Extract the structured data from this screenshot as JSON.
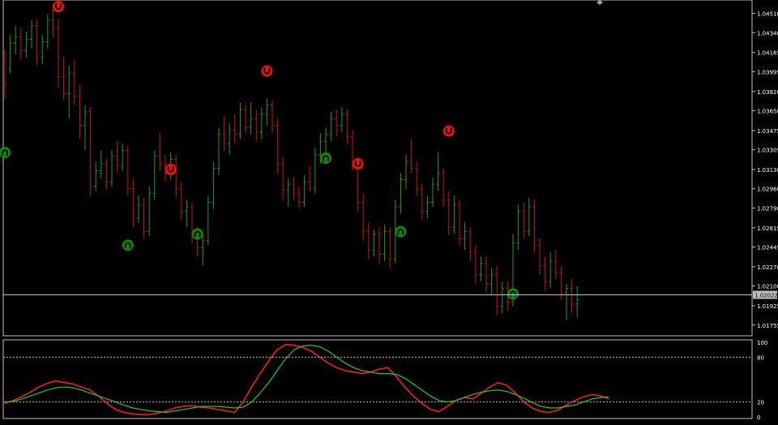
{
  "colors": {
    "background": "#000000",
    "frame": "#c0c0c0",
    "bull_bar": "#1f9a1f",
    "bear_bar": "#d01010",
    "stoch_main": "#ff1a1a",
    "stoch_signal": "#22cc22",
    "level_line": "#c0c0c0",
    "price_label_bg": "#c0c0c0",
    "axis_text": "#ffffff",
    "arrow_up": "#0a8a0a",
    "arrow_down": "#ee1111"
  },
  "chart_data": [
    {
      "type": "ohlc",
      "price_axis": {
        "ylim": [
          1.0166,
          1.046
        ],
        "ticks": [
          "1.04510",
          "1.04340",
          "1.04165",
          "1.03995",
          "1.03820",
          "1.03650",
          "1.03475",
          "1.03305",
          "1.03130",
          "1.02960",
          "1.02790",
          "1.02615",
          "1.02445",
          "1.02270",
          "1.02100",
          "1.01925",
          "1.01755"
        ],
        "current_price": "1.02022"
      },
      "bars": [
        [
          1.0408,
          1.0419,
          1.0376,
          1.0388
        ],
        [
          1.0402,
          1.0432,
          1.0398,
          1.0425
        ],
        [
          1.0425,
          1.044,
          1.0415,
          1.043
        ],
        [
          1.043,
          1.0438,
          1.041,
          1.0418
        ],
        [
          1.0418,
          1.0435,
          1.0412,
          1.0428
        ],
        [
          1.0428,
          1.0445,
          1.042,
          1.044
        ],
        [
          1.044,
          1.0446,
          1.0405,
          1.0412
        ],
        [
          1.0412,
          1.0432,
          1.0406,
          1.0426
        ],
        [
          1.0426,
          1.045,
          1.042,
          1.0445
        ],
        [
          1.0445,
          1.0455,
          1.043,
          1.0438
        ],
        [
          1.0438,
          1.0446,
          1.0385,
          1.0395
        ],
        [
          1.0395,
          1.0412,
          1.0375,
          1.038
        ],
        [
          1.038,
          1.0405,
          1.0358,
          1.0398
        ],
        [
          1.0398,
          1.041,
          1.037,
          1.0378
        ],
        [
          1.0378,
          1.0388,
          1.034,
          1.0352
        ],
        [
          1.0352,
          1.037,
          1.033,
          1.0364
        ],
        [
          1.0364,
          1.0368,
          1.029,
          1.0298
        ],
        [
          1.0298,
          1.032,
          1.0294,
          1.0312
        ],
        [
          1.0312,
          1.033,
          1.0305,
          1.0318
        ],
        [
          1.0318,
          1.0322,
          1.0296,
          1.0302
        ],
        [
          1.0302,
          1.033,
          1.0298,
          1.0325
        ],
        [
          1.0325,
          1.0338,
          1.031,
          1.0316
        ],
        [
          1.0316,
          1.0336,
          1.0312,
          1.033
        ],
        [
          1.033,
          1.0334,
          1.029,
          1.0296
        ],
        [
          1.0296,
          1.0305,
          1.0262,
          1.027
        ],
        [
          1.027,
          1.029,
          1.0266,
          1.0282
        ],
        [
          1.0282,
          1.0288,
          1.0252,
          1.0258
        ],
        [
          1.0258,
          1.0298,
          1.0254,
          1.0292
        ],
        [
          1.0292,
          1.033,
          1.0286,
          1.0325
        ],
        [
          1.0325,
          1.0345,
          1.0312,
          1.0318
        ],
        [
          1.0318,
          1.0326,
          1.0302,
          1.031
        ],
        [
          1.031,
          1.0328,
          1.0304,
          1.0322
        ],
        [
          1.0322,
          1.0326,
          1.0288,
          1.0296
        ],
        [
          1.0296,
          1.0302,
          1.0268,
          1.0276
        ],
        [
          1.0276,
          1.0286,
          1.0262,
          1.028
        ],
        [
          1.028,
          1.0284,
          1.0248,
          1.0256
        ],
        [
          1.0256,
          1.0262,
          1.0236,
          1.0244
        ],
        [
          1.0244,
          1.0258,
          1.0228,
          1.025
        ],
        [
          1.025,
          1.029,
          1.0246,
          1.0284
        ],
        [
          1.0284,
          1.032,
          1.0278,
          1.0314
        ],
        [
          1.0314,
          1.035,
          1.0308,
          1.0344
        ],
        [
          1.0344,
          1.036,
          1.033,
          1.0336
        ],
        [
          1.0336,
          1.0354,
          1.0326,
          1.0348
        ],
        [
          1.0348,
          1.0362,
          1.0336,
          1.0344
        ],
        [
          1.0344,
          1.0372,
          1.034,
          1.0366
        ],
        [
          1.0366,
          1.037,
          1.0345,
          1.035
        ],
        [
          1.035,
          1.0372,
          1.0344,
          1.0358
        ],
        [
          1.0358,
          1.0366,
          1.0338,
          1.0346
        ],
        [
          1.0346,
          1.0368,
          1.034,
          1.0362
        ],
        [
          1.0362,
          1.0376,
          1.0352,
          1.037
        ],
        [
          1.037,
          1.0374,
          1.0345,
          1.0352
        ],
        [
          1.0352,
          1.0358,
          1.031,
          1.0318
        ],
        [
          1.0318,
          1.0324,
          1.0286,
          1.0295
        ],
        [
          1.0295,
          1.0305,
          1.028,
          1.03
        ],
        [
          1.03,
          1.0306,
          1.0286,
          1.0292
        ],
        [
          1.0292,
          1.0298,
          1.0278,
          1.0284
        ],
        [
          1.0284,
          1.0308,
          1.028,
          1.0302
        ],
        [
          1.0302,
          1.0316,
          1.0294,
          1.0296
        ],
        [
          1.0296,
          1.0332,
          1.0292,
          1.0326
        ],
        [
          1.0326,
          1.0345,
          1.0318,
          1.0338
        ],
        [
          1.0338,
          1.035,
          1.0326,
          1.0344
        ],
        [
          1.0344,
          1.0364,
          1.0338,
          1.0358
        ],
        [
          1.0358,
          1.0366,
          1.0342,
          1.0352
        ],
        [
          1.0352,
          1.0368,
          1.0346,
          1.0362
        ],
        [
          1.0362,
          1.0366,
          1.0336,
          1.0342
        ],
        [
          1.0342,
          1.0348,
          1.0312,
          1.0318
        ],
        [
          1.0318,
          1.0324,
          1.0276,
          1.0284
        ],
        [
          1.0284,
          1.0292,
          1.025,
          1.0258
        ],
        [
          1.0258,
          1.0266,
          1.0234,
          1.0242
        ],
        [
          1.0242,
          1.026,
          1.0236,
          1.0256
        ],
        [
          1.0256,
          1.0262,
          1.023,
          1.0238
        ],
        [
          1.0238,
          1.0264,
          1.0232,
          1.0258
        ],
        [
          1.0258,
          1.0262,
          1.0226,
          1.0234
        ],
        [
          1.0234,
          1.0286,
          1.023,
          1.028
        ],
        [
          1.028,
          1.031,
          1.0274,
          1.0304
        ],
        [
          1.0304,
          1.0326,
          1.0296,
          1.032
        ],
        [
          1.032,
          1.034,
          1.031,
          1.0314
        ],
        [
          1.0314,
          1.032,
          1.029,
          1.0296
        ],
        [
          1.0296,
          1.03,
          1.0268,
          1.0276
        ],
        [
          1.0276,
          1.029,
          1.027,
          1.0284
        ],
        [
          1.0284,
          1.0306,
          1.028,
          1.03
        ],
        [
          1.03,
          1.0328,
          1.0294,
          1.031
        ],
        [
          1.031,
          1.0314,
          1.028,
          1.0286
        ],
        [
          1.0286,
          1.0294,
          1.0255,
          1.0262
        ],
        [
          1.0262,
          1.029,
          1.0256,
          1.0282
        ],
        [
          1.0282,
          1.0286,
          1.0246,
          1.0252
        ],
        [
          1.0252,
          1.0266,
          1.0242,
          1.0258
        ],
        [
          1.0258,
          1.0262,
          1.0232,
          1.024
        ],
        [
          1.024,
          1.0246,
          1.0212,
          1.022
        ],
        [
          1.022,
          1.0236,
          1.0214,
          1.023
        ],
        [
          1.023,
          1.0236,
          1.0204,
          1.0212
        ],
        [
          1.0212,
          1.0226,
          1.0202,
          1.022
        ],
        [
          1.022,
          1.0228,
          1.0184,
          1.0192
        ],
        [
          1.0192,
          1.0214,
          1.0186,
          1.0208
        ],
        [
          1.0208,
          1.0214,
          1.0188,
          1.0196
        ],
        [
          1.0196,
          1.0256,
          1.0192,
          1.0248
        ],
        [
          1.0248,
          1.0282,
          1.0242,
          1.0276
        ],
        [
          1.0276,
          1.0284,
          1.0252,
          1.0258
        ],
        [
          1.0258,
          1.0288,
          1.0254,
          1.028
        ],
        [
          1.028,
          1.0286,
          1.024,
          1.0246
        ],
        [
          1.0246,
          1.0252,
          1.022,
          1.0228
        ],
        [
          1.0228,
          1.0236,
          1.0206,
          1.0214
        ],
        [
          1.0214,
          1.024,
          1.0208,
          1.0232
        ],
        [
          1.0232,
          1.0242,
          1.0216,
          1.0222
        ],
        [
          1.0222,
          1.0228,
          1.0198,
          1.0204
        ],
        [
          1.0204,
          1.0212,
          1.018,
          1.0208
        ],
        [
          1.0208,
          1.0216,
          1.0186,
          1.0194
        ],
        [
          1.0194,
          1.021,
          1.0182,
          1.0198
        ]
      ],
      "arrows": [
        {
          "bar": 10,
          "direction": "down",
          "price": 1.0457
        },
        {
          "bar": 0,
          "direction": "up",
          "price": 1.0328
        },
        {
          "bar": 23,
          "direction": "up",
          "price": 1.0246
        },
        {
          "bar": 31,
          "direction": "down",
          "price": 1.0313
        },
        {
          "bar": 36,
          "direction": "up",
          "price": 1.0256
        },
        {
          "bar": 49,
          "direction": "down",
          "price": 1.04
        },
        {
          "bar": 60,
          "direction": "up",
          "price": 1.0323
        },
        {
          "bar": 66,
          "direction": "down",
          "price": 1.0318
        },
        {
          "bar": 74,
          "direction": "up",
          "price": 1.0258
        },
        {
          "bar": 83,
          "direction": "down",
          "price": 1.0347
        },
        {
          "bar": 95,
          "direction": "up",
          "price": 1.0203
        }
      ]
    },
    {
      "type": "line",
      "indicator_axis": {
        "ylim": [
          0,
          100
        ],
        "ticks": [
          "100",
          "80",
          "20",
          "0"
        ],
        "levels": [
          80,
          20
        ]
      },
      "series": [
        {
          "values": [
            18,
            22,
            27,
            33,
            40,
            45,
            48,
            46,
            44,
            40,
            36,
            28,
            18,
            10,
            6,
            4,
            3,
            3,
            5,
            8,
            12,
            14,
            15,
            13,
            12,
            10,
            8,
            6,
            20,
            40,
            58,
            75,
            90,
            97,
            96,
            93,
            88,
            80,
            72,
            66,
            62,
            60,
            58,
            60,
            64,
            66,
            54,
            40,
            28,
            18,
            10,
            7,
            14,
            22,
            26,
            24,
            32,
            40,
            46,
            42,
            32,
            20,
            12,
            7,
            6,
            9,
            16,
            22,
            27,
            30,
            28,
            24
          ]
        },
        {
          "values": [
            20,
            21,
            24,
            28,
            32,
            36,
            39,
            40,
            39,
            36,
            32,
            28,
            24,
            20,
            16,
            12,
            10,
            8,
            7,
            6,
            8,
            10,
            12,
            14,
            14,
            14,
            13,
            12,
            13,
            20,
            32,
            46,
            62,
            78,
            90,
            95,
            96,
            94,
            88,
            80,
            72,
            66,
            62,
            60,
            58,
            58,
            57,
            52,
            44,
            36,
            28,
            22,
            20,
            22,
            26,
            30,
            33,
            35,
            36,
            34,
            30,
            25,
            19,
            14,
            12,
            12,
            14,
            16,
            20,
            24,
            26,
            27
          ]
        }
      ]
    }
  ]
}
